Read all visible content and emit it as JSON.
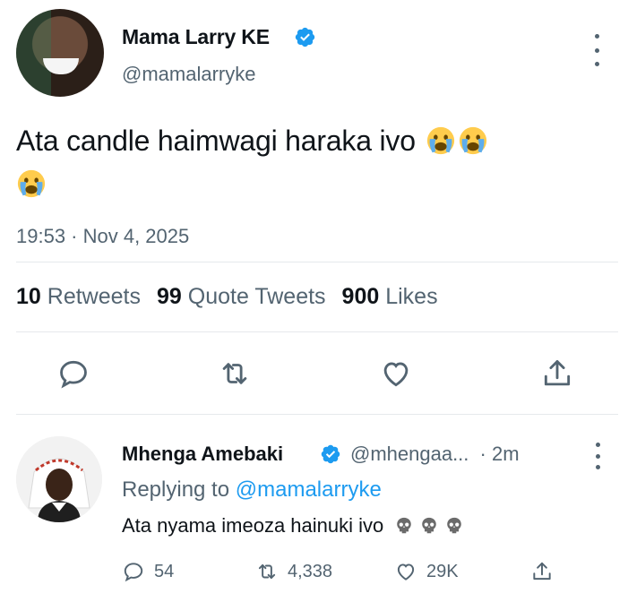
{
  "tweet": {
    "author_name": "Mama Larry KE",
    "author_handle": "@mamalarryke",
    "text": "Ata candle haimwagi haraka ivo",
    "emoji": [
      "crying-face",
      "crying-face",
      "crying-face"
    ],
    "timestamp": "19:53 · Nov 4, 2025",
    "stats": {
      "retweets_count": "10",
      "retweets_label": "Retweets",
      "quotes_count": "99",
      "quotes_label": "Quote Tweets",
      "likes_count": "900",
      "likes_label": "Likes"
    }
  },
  "reply": {
    "author_name": "Mhenga Amebaki",
    "author_handle": "@mhengaa...",
    "time": "· 2m",
    "replying_prefix": "Replying to",
    "replying_to": "@mamalarryke",
    "text": "Ata nyama imeoza hainuki ivo",
    "emoji": [
      "skull",
      "skull",
      "skull"
    ],
    "actions": {
      "replies": "54",
      "retweets": "4,338",
      "likes": "29K"
    }
  },
  "colors": {
    "text": "#0f1419",
    "secondary": "#536471",
    "accent": "#1d9bf0",
    "verified": "#1d9bf0",
    "divider": "#e6e9ec"
  }
}
